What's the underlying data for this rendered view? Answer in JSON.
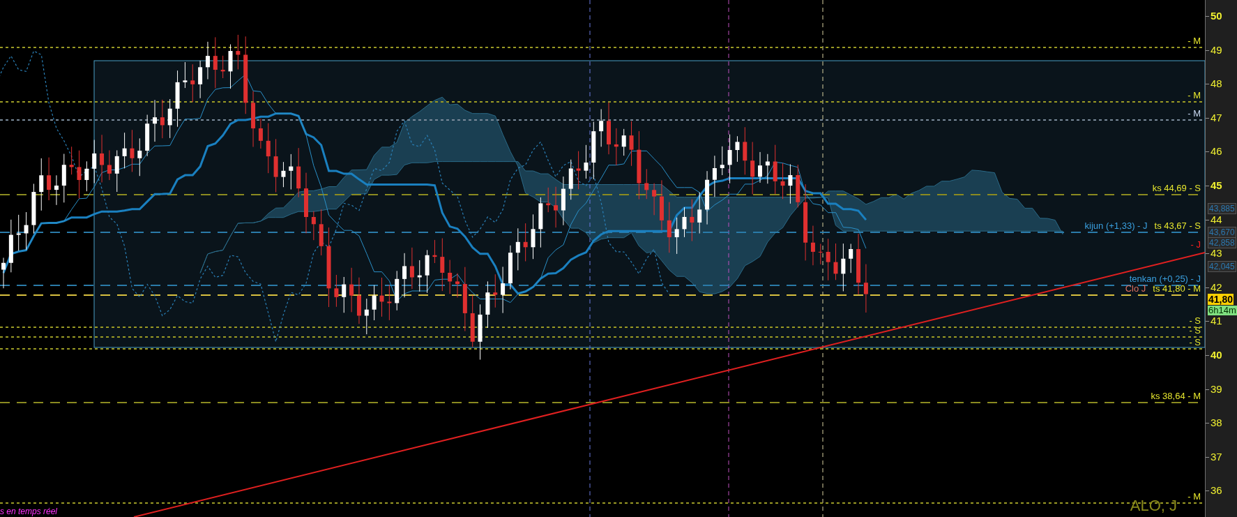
{
  "chart": {
    "symbol": "ALO, J",
    "footer_note": "s en temps réel",
    "trend_line": {
      "color": "#e02020",
      "label": {
        "text": "- J",
        "color": "#ff2020"
      }
    },
    "levels": [
      {
        "kind": "dotted",
        "color": "#9a9a24",
        "labels": [
          {
            "text": "- M",
            "color": "#e6e62e"
          }
        ]
      },
      {
        "kind": "dotted",
        "color": "#9a9a24",
        "labels": [
          {
            "text": "- M",
            "color": "#e6e62e"
          }
        ]
      },
      {
        "kind": "dotted",
        "color": "#7a8a9a",
        "labels": [
          {
            "text": "- M",
            "color": "#c8d8f0"
          }
        ]
      },
      {
        "kind": "dashed",
        "color": "#8a8a20",
        "labels": [
          {
            "text": "ks 44,69 - S",
            "color": "#e6e62e"
          }
        ]
      },
      {
        "kind": "dashed",
        "color": "#2a7aa8",
        "labels": [
          {
            "text": "kijun (+1,33) - J",
            "color": "#3aa0e0"
          },
          {
            "text": "ts 43,67 - S",
            "color": "#e6e62e"
          }
        ]
      },
      {
        "kind": "dashed",
        "color": "#2a7aa8",
        "labels": [
          {
            "text": "tenkan (+0,25) - J",
            "color": "#3aa0e0"
          }
        ]
      },
      {
        "kind": "dashed",
        "color": "#d8c040",
        "labels": [
          {
            "text": "Clo J",
            "color": "#e07060"
          },
          {
            "text": "ts 41,80 - M",
            "color": "#e6e62e"
          }
        ]
      },
      {
        "kind": "dotted",
        "color": "#9a9a24",
        "labels": [
          {
            "text": "- S",
            "color": "#e6e62e"
          }
        ]
      },
      {
        "kind": "dotted",
        "color": "#9a9a24",
        "labels": [
          {
            "text": "- S",
            "color": "#e6e62e"
          }
        ]
      },
      {
        "kind": "dotted",
        "color": "#9a9a24",
        "labels": [
          {
            "text": "- S",
            "color": "#e6e62e"
          }
        ]
      },
      {
        "kind": "dashed",
        "color": "#8a8a20",
        "labels": [
          {
            "text": "ks 38,64 - M",
            "color": "#e6e62e"
          }
        ]
      },
      {
        "kind": "dotted",
        "color": "#9a9a24",
        "labels": [
          {
            "text": "- M",
            "color": "#e6e62e"
          }
        ]
      }
    ]
  },
  "price_axis": {
    "ticks": [
      "50",
      "49",
      "48",
      "47",
      "46",
      "45",
      "44",
      "43",
      "42",
      "41",
      "40",
      "39",
      "38",
      "37",
      "36"
    ],
    "tags": [
      {
        "kind": "indicator",
        "text": "43,885"
      },
      {
        "kind": "indicator",
        "text": "43,670"
      },
      {
        "kind": "indicator",
        "text": "42,858"
      },
      {
        "kind": "indicator",
        "text": "42,045"
      },
      {
        "kind": "last",
        "text": "41,80"
      },
      {
        "kind": "timer",
        "text": "6h14m"
      }
    ]
  }
}
